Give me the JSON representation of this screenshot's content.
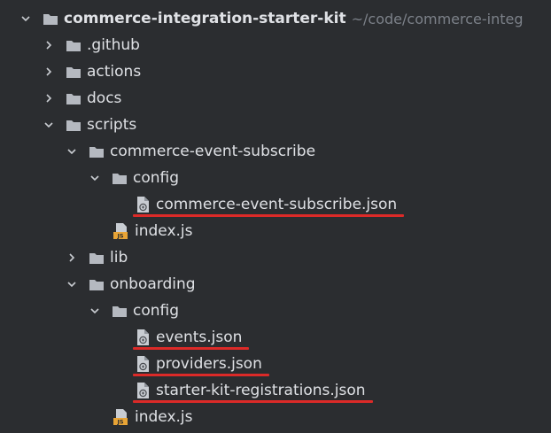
{
  "tree": [
    {
      "label": "commerce-integration-starter-kit",
      "path": "~/code/commerce-integ",
      "type": "folder",
      "depth": 0,
      "expanded": true,
      "bold": true
    },
    {
      "label": ".github",
      "type": "folder",
      "depth": 1,
      "expanded": false
    },
    {
      "label": "actions",
      "type": "folder",
      "depth": 1,
      "expanded": false
    },
    {
      "label": "docs",
      "type": "folder",
      "depth": 1,
      "expanded": false
    },
    {
      "label": "scripts",
      "type": "folder",
      "depth": 1,
      "expanded": true
    },
    {
      "label": "commerce-event-subscribe",
      "type": "folder",
      "depth": 2,
      "expanded": true
    },
    {
      "label": "config",
      "type": "folder",
      "depth": 3,
      "expanded": true
    },
    {
      "label": "commerce-event-subscribe.json",
      "type": "json",
      "depth": 4,
      "highlighted": true
    },
    {
      "label": "index.js",
      "type": "js",
      "depth": 3
    },
    {
      "label": "lib",
      "type": "folder",
      "depth": 2,
      "expanded": false
    },
    {
      "label": "onboarding",
      "type": "folder",
      "depth": 2,
      "expanded": true
    },
    {
      "label": "config",
      "type": "folder",
      "depth": 3,
      "expanded": true
    },
    {
      "label": "events.json",
      "type": "json",
      "depth": 4,
      "highlighted": true
    },
    {
      "label": "providers.json",
      "type": "json",
      "depth": 4,
      "highlighted": true
    },
    {
      "label": "starter-kit-registrations.json",
      "type": "json",
      "depth": 4,
      "highlighted": true
    },
    {
      "label": "index.js",
      "type": "js",
      "depth": 3
    }
  ],
  "colors": {
    "background": "#2b2d30",
    "text": "#dfe1e5",
    "folder": "#b5b9c0",
    "highlight": "#dc2a28",
    "js_badge": "#e8a436"
  }
}
